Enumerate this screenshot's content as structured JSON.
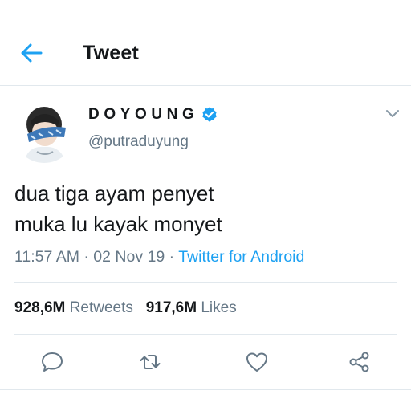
{
  "header": {
    "back_icon": "back-arrow-icon",
    "title": "Tweet"
  },
  "author": {
    "display_name": "DOYOUNG",
    "verified_icon": "verified-badge-icon",
    "handle": "@putraduyung",
    "menu_icon": "chevron-down-icon"
  },
  "tweet": {
    "lines": [
      "dua tiga ayam penyet",
      "muka lu kayak monyet"
    ],
    "time": "11:57 AM",
    "separator": "·",
    "date": "02 Nov 19",
    "source": "Twitter for Android"
  },
  "stats": {
    "retweets_count": "928,6M",
    "retweets_label": "Retweets",
    "likes_count": "917,6M",
    "likes_label": "Likes"
  },
  "actions": [
    {
      "icon": "reply-icon"
    },
    {
      "icon": "retweet-icon"
    },
    {
      "icon": "like-icon"
    },
    {
      "icon": "share-icon"
    }
  ],
  "colors": {
    "accent": "#1da1f2",
    "text": "#14171a",
    "secondary_text": "#657786",
    "divider": "#e1e8ed",
    "icon": "#657786"
  }
}
